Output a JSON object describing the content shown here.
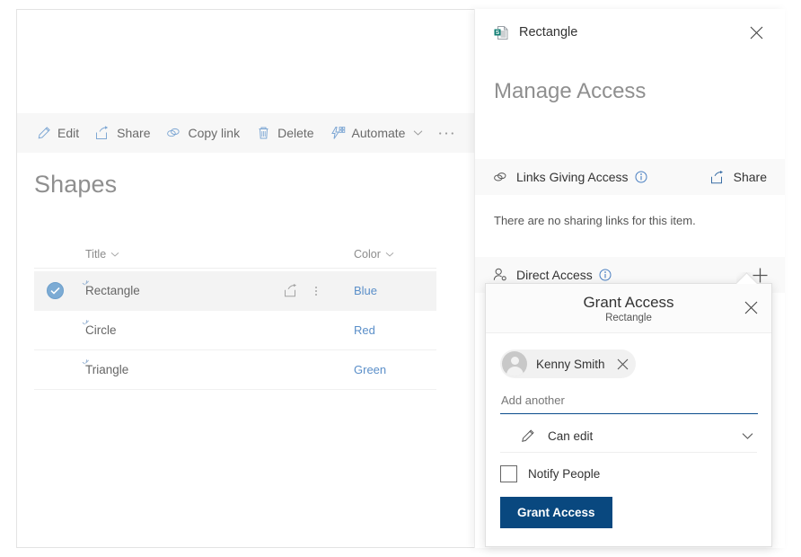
{
  "commandbar": {
    "items": [
      {
        "label": "Edit",
        "icon": "pencil-icon",
        "chevron": false
      },
      {
        "label": "Share",
        "icon": "share-icon",
        "chevron": false
      },
      {
        "label": "Copy link",
        "icon": "link-icon",
        "chevron": false
      },
      {
        "label": "Delete",
        "icon": "trash-icon",
        "chevron": false
      },
      {
        "label": "Automate",
        "icon": "automate-icon",
        "chevron": true
      }
    ],
    "overflow_label": "..."
  },
  "list": {
    "title": "Shapes",
    "columns": [
      {
        "label": "Title"
      },
      {
        "label": "Color"
      }
    ],
    "rows": [
      {
        "title": "Rectangle",
        "color": "Blue",
        "selected": true
      },
      {
        "title": "Circle",
        "color": "Red",
        "selected": false
      },
      {
        "title": "Triangle",
        "color": "Green",
        "selected": false
      }
    ]
  },
  "panel": {
    "header_title": "Rectangle",
    "header_icon": "sharepoint-list-item-icon",
    "close_icon": "close-icon",
    "main_title": "Manage Access",
    "links_section": {
      "label": "Links Giving Access",
      "icon": "link-icon",
      "info_icon": "info-icon",
      "action_label": "Share",
      "action_icon": "share-icon",
      "empty_text": "There are no sharing links for this item."
    },
    "direct_section": {
      "label": "Direct Access",
      "icon": "person-icon",
      "info_icon": "info-icon",
      "add_icon": "plus-icon"
    }
  },
  "callout": {
    "title": "Grant Access",
    "subtitle": "Rectangle",
    "close_icon": "close-icon",
    "person": {
      "name": "Kenny Smith",
      "avatar_icon": "person-avatar-icon",
      "remove_icon": "close-icon"
    },
    "add_another_placeholder": "Add another",
    "permission": {
      "label": "Can edit",
      "icon": "pencil-icon",
      "chevron_icon": "chevron-down-icon"
    },
    "notify": {
      "label": "Notify People",
      "checked": false
    },
    "submit_label": "Grant Access"
  },
  "colors": {
    "accent_blue": "#09487f",
    "link_blue": "#5b8fc9",
    "selection_blue": "#7cabd4",
    "panel_section_bg": "#f9f9f9",
    "commandbar_bg": "#f7f7f7"
  }
}
